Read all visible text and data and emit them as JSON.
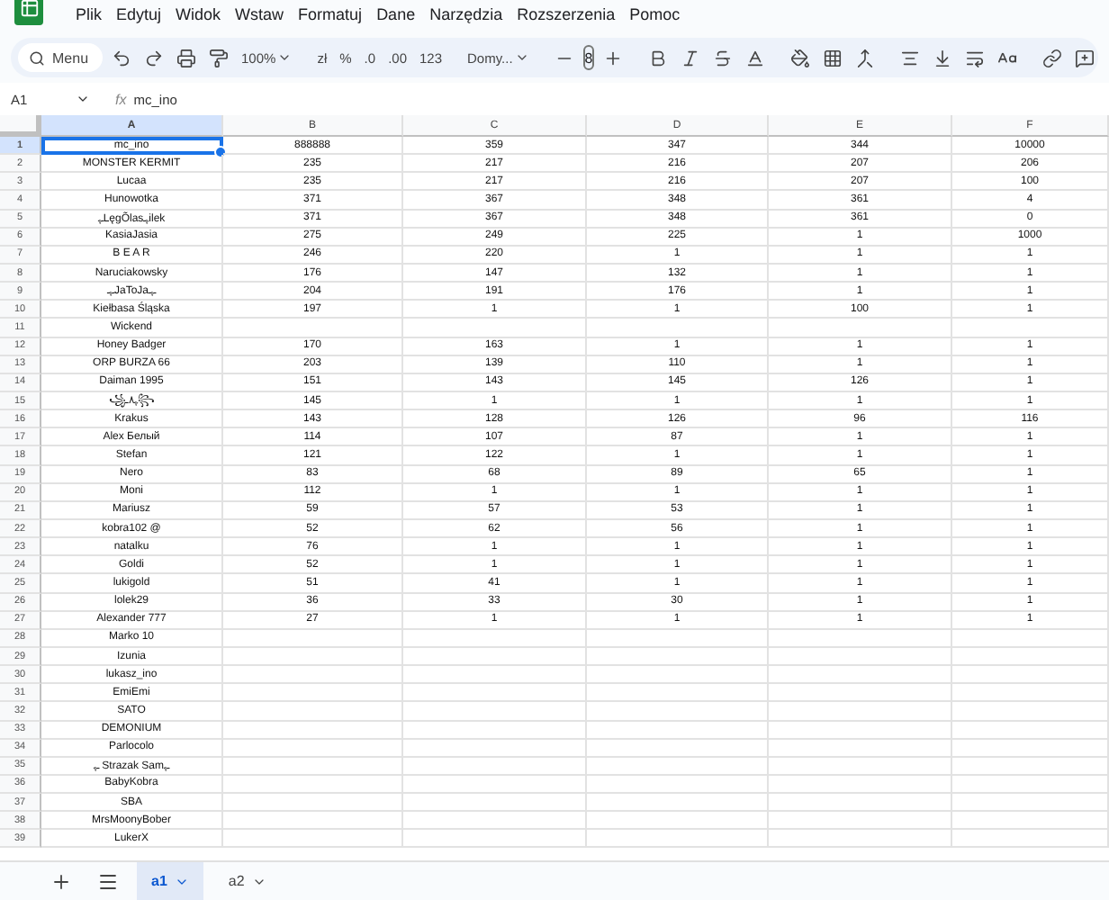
{
  "menu": [
    "Plik",
    "Edytuj",
    "Widok",
    "Wstaw",
    "Formatuj",
    "Dane",
    "Narzędzia",
    "Rozszerzenia",
    "Pomoc"
  ],
  "toolbar": {
    "search": "Menu",
    "zoom": "100%",
    "currency": "zł",
    "percent": "%",
    "dec_less": ".0",
    "dec_more": ".00",
    "number_format": "123",
    "font": "Domy...",
    "font_size": "8"
  },
  "formula_bar": {
    "cell": "A1",
    "fx": "fx",
    "value": "mc_ino"
  },
  "columns": [
    {
      "label": "A",
      "selected": true
    },
    {
      "label": "B",
      "selected": false
    },
    {
      "label": "C",
      "selected": false
    },
    {
      "label": "D",
      "selected": false
    },
    {
      "label": "E",
      "selected": false
    },
    {
      "label": "F",
      "selected": false
    }
  ],
  "rows": [
    {
      "n": "1",
      "selected": true,
      "cells": [
        "mc_ino",
        "888888",
        "359",
        "347",
        "344",
        "10000"
      ]
    },
    {
      "n": "2",
      "selected": false,
      "cells": [
        "MONSTER KERMIT",
        "235",
        "217",
        "216",
        "207",
        "206"
      ]
    },
    {
      "n": "3",
      "selected": false,
      "cells": [
        "Lucaa",
        "235",
        "217",
        "216",
        "207",
        "100"
      ]
    },
    {
      "n": "4",
      "selected": false,
      "cells": [
        "Hunowotka",
        "371",
        "367",
        "348",
        "361",
        "4"
      ]
    },
    {
      "n": "5",
      "selected": false,
      "cells": [
        "ـﮩLęgÕlasﮩـilek",
        "371",
        "367",
        "348",
        "361",
        "0"
      ]
    },
    {
      "n": "6",
      "selected": false,
      "cells": [
        "KasiaJasia",
        "275",
        "249",
        "225",
        "1",
        "1000"
      ]
    },
    {
      "n": "7",
      "selected": false,
      "cells": [
        "B E A R",
        "246",
        "220",
        "1",
        "1",
        "1"
      ]
    },
    {
      "n": "8",
      "selected": false,
      "cells": [
        "Naruciakowsky",
        "176",
        "147",
        "132",
        "1",
        "1"
      ]
    },
    {
      "n": "9",
      "selected": false,
      "cells": [
        "ـﮩـJaToJaـﮩـ",
        "204",
        "191",
        "176",
        "1",
        "1"
      ]
    },
    {
      "n": "10",
      "selected": false,
      "cells": [
        "Kiełbasa Śląska",
        "197",
        "1",
        "1",
        "100",
        "1"
      ]
    },
    {
      "n": "11",
      "selected": false,
      "cells": [
        "Wickend",
        null,
        null,
        null,
        null,
        null
      ]
    },
    {
      "n": "12",
      "selected": false,
      "cells": [
        "Honey Badger",
        "170",
        "163",
        "1",
        "1",
        "1"
      ]
    },
    {
      "n": "13",
      "selected": false,
      "cells": [
        "ORP BURZA 66",
        "203",
        "139",
        "110",
        "1",
        "1"
      ]
    },
    {
      "n": "14",
      "selected": false,
      "cells": [
        "Daiman 1995",
        "151",
        "143",
        "145",
        "126",
        "1"
      ]
    },
    {
      "n": "15",
      "selected": false,
      "cells": [
        "꧁ﮩ٨ـ꧂",
        "145",
        "1",
        "1",
        "1",
        "1"
      ]
    },
    {
      "n": "16",
      "selected": false,
      "cells": [
        "Krakus",
        "143",
        "128",
        "126",
        "96",
        "116"
      ]
    },
    {
      "n": "17",
      "selected": false,
      "cells": [
        "Alex Белый",
        "114",
        "107",
        "87",
        "1",
        "1"
      ]
    },
    {
      "n": "18",
      "selected": false,
      "cells": [
        "Stefan",
        "121",
        "122",
        "1",
        "1",
        "1"
      ]
    },
    {
      "n": "19",
      "selected": false,
      "cells": [
        "Nero",
        "83",
        "68",
        "89",
        "65",
        "1"
      ]
    },
    {
      "n": "20",
      "selected": false,
      "cells": [
        "Moni",
        "112",
        "1",
        "1",
        "1",
        "1"
      ]
    },
    {
      "n": "21",
      "selected": false,
      "cells": [
        "Mariusz",
        "59",
        "57",
        "53",
        "1",
        "1"
      ]
    },
    {
      "n": "22",
      "selected": false,
      "cells": [
        "kobra102 @",
        "52",
        "62",
        "56",
        "1",
        "1"
      ]
    },
    {
      "n": "23",
      "selected": false,
      "cells": [
        "natalku",
        "76",
        "1",
        "1",
        "1",
        "1"
      ]
    },
    {
      "n": "24",
      "selected": false,
      "cells": [
        "Goldi",
        "52",
        "1",
        "1",
        "1",
        "1"
      ]
    },
    {
      "n": "25",
      "selected": false,
      "cells": [
        "lukigold",
        "51",
        "41",
        "1",
        "1",
        "1"
      ]
    },
    {
      "n": "26",
      "selected": false,
      "cells": [
        "lolek29",
        "36",
        "33",
        "30",
        "1",
        "1"
      ]
    },
    {
      "n": "27",
      "selected": false,
      "cells": [
        "Alexander 777",
        "27",
        "1",
        "1",
        "1",
        "1"
      ]
    },
    {
      "n": "28",
      "selected": false,
      "cells": [
        "Marko 10",
        null,
        null,
        null,
        null,
        null
      ]
    },
    {
      "n": "29",
      "selected": false,
      "cells": [
        "Izunia",
        null,
        null,
        null,
        null,
        null
      ]
    },
    {
      "n": "30",
      "selected": false,
      "cells": [
        "lukasz_ino",
        null,
        null,
        null,
        null,
        null
      ]
    },
    {
      "n": "31",
      "selected": false,
      "cells": [
        "EmiEmi",
        null,
        null,
        null,
        null,
        null
      ]
    },
    {
      "n": "32",
      "selected": false,
      "cells": [
        "SATO",
        null,
        null,
        null,
        null,
        null
      ]
    },
    {
      "n": "33",
      "selected": false,
      "cells": [
        "DEMONIUM",
        null,
        null,
        null,
        null,
        null
      ]
    },
    {
      "n": "34",
      "selected": false,
      "cells": [
        "Parlocolo",
        null,
        null,
        null,
        null,
        null
      ]
    },
    {
      "n": "35",
      "selected": false,
      "cells": [
        "ـﮩ Strazak Samـﮩ",
        null,
        null,
        null,
        null,
        null
      ]
    },
    {
      "n": "36",
      "selected": false,
      "cells": [
        "BabyKobra",
        null,
        null,
        null,
        null,
        null
      ]
    },
    {
      "n": "37",
      "selected": false,
      "cells": [
        "SBA",
        null,
        null,
        null,
        null,
        null
      ]
    },
    {
      "n": "38",
      "selected": false,
      "cells": [
        "MrsMoonyBober",
        null,
        null,
        null,
        null,
        null
      ]
    },
    {
      "n": "39",
      "selected": false,
      "cells": [
        "LukerX",
        null,
        null,
        null,
        null,
        null
      ]
    }
  ],
  "sheets": [
    {
      "label": "a1",
      "selected": true
    },
    {
      "label": "a2",
      "selected": false
    }
  ]
}
